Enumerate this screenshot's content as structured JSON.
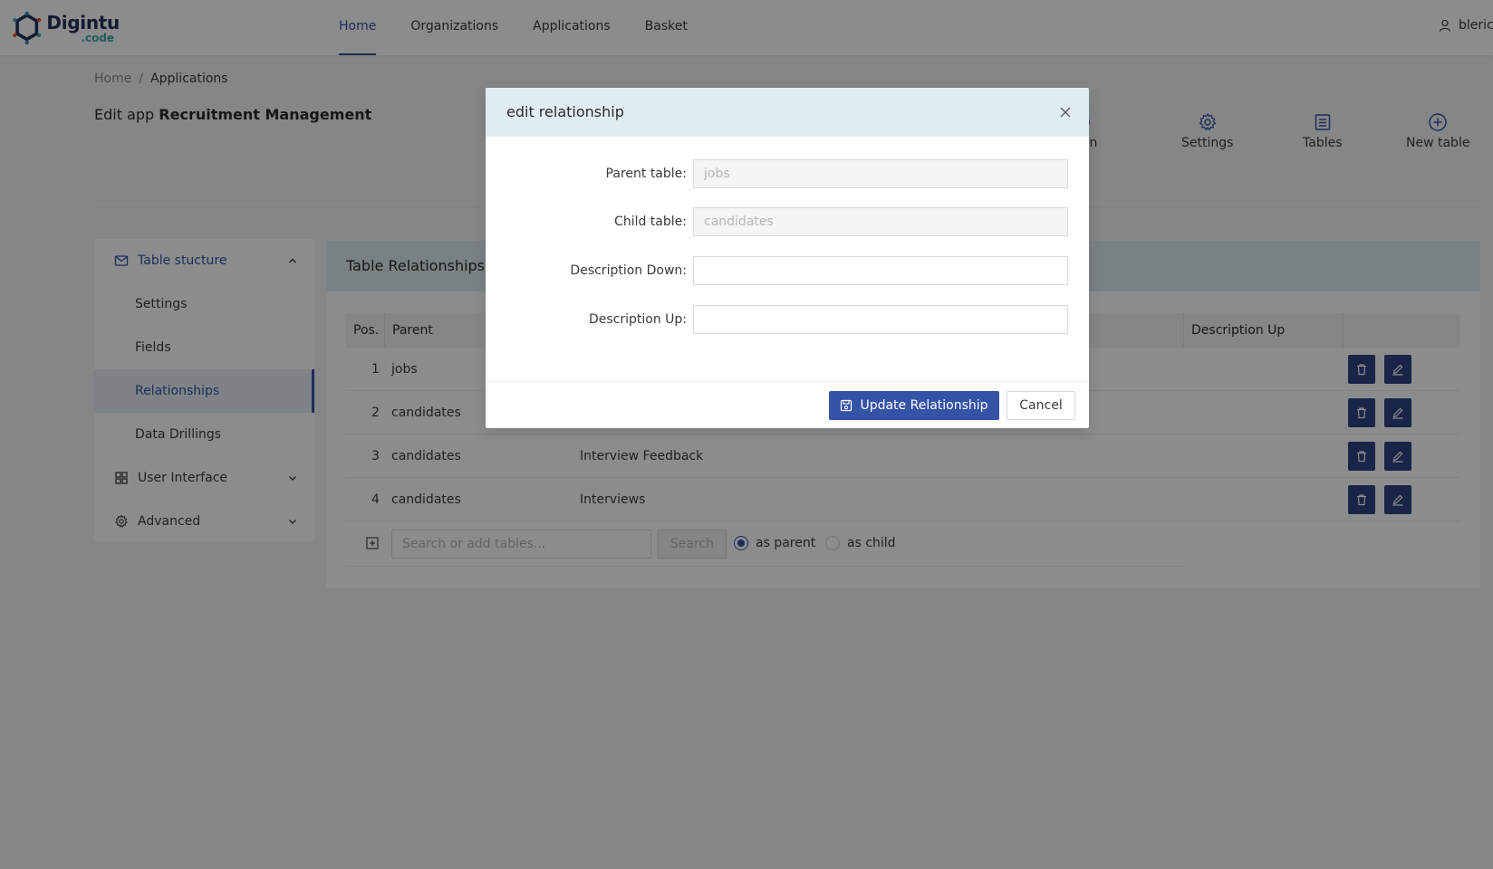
{
  "brand": {
    "name": "Digintu",
    "sub": ".code"
  },
  "nav": [
    {
      "label": "Home",
      "active": true
    },
    {
      "label": "Organizations",
      "active": false
    },
    {
      "label": "Applications",
      "active": false
    },
    {
      "label": "Basket",
      "active": false
    }
  ],
  "user": {
    "name": "bleric"
  },
  "breadcrumb": {
    "home": "Home",
    "sep": "/",
    "current": "Applications"
  },
  "page": {
    "title_prefix": "Edit app",
    "title_app": "Recruitment Management"
  },
  "actions": [
    {
      "label": "Open",
      "icon": "play-circle-icon"
    },
    {
      "label": "Settings",
      "icon": "gear-icon"
    },
    {
      "label": "Tables",
      "icon": "list-icon"
    },
    {
      "label": "New table",
      "icon": "plus-circle-icon"
    }
  ],
  "sidebar": {
    "groups": [
      {
        "label": "Table stucture",
        "icon": "mail-icon",
        "open": true
      },
      {
        "label": "User Interface",
        "icon": "grid-icon",
        "open": false
      },
      {
        "label": "Advanced",
        "icon": "gear-icon",
        "open": false
      }
    ],
    "items": [
      {
        "label": "Settings",
        "selected": false
      },
      {
        "label": "Fields",
        "selected": false
      },
      {
        "label": "Relationships",
        "selected": true
      },
      {
        "label": "Data Drillings",
        "selected": false
      }
    ]
  },
  "card": {
    "title": "Table Relationships",
    "columns": [
      "Pos.",
      "Parent",
      "Description Up"
    ],
    "rows": [
      {
        "pos": "1",
        "parent": "jobs",
        "child": ""
      },
      {
        "pos": "2",
        "parent": "candidates",
        "child": ""
      },
      {
        "pos": "3",
        "parent": "candidates",
        "child": "Interview Feedback"
      },
      {
        "pos": "4",
        "parent": "candidates",
        "child": "Interviews"
      }
    ],
    "search_placeholder": "Search or add tables...",
    "search_button": "Search",
    "radio_parent": "as parent",
    "radio_child": "as child"
  },
  "modal": {
    "title": "edit relationship",
    "fields": [
      {
        "label": "Parent table",
        "placeholder": "jobs",
        "disabled": true
      },
      {
        "label": "Child table",
        "placeholder": "candidates",
        "disabled": true
      },
      {
        "label": "Description Down",
        "placeholder": "",
        "disabled": false
      },
      {
        "label": "Description Up",
        "placeholder": "",
        "disabled": false
      }
    ],
    "label_suffix": ":",
    "primary_button": "Update Relationship",
    "cancel_button": "Cancel"
  },
  "colors": {
    "primary": "#3553a6",
    "dark_button": "#2e4484",
    "header_tint": "#dfecf1",
    "teal": "#3fa7a8"
  }
}
